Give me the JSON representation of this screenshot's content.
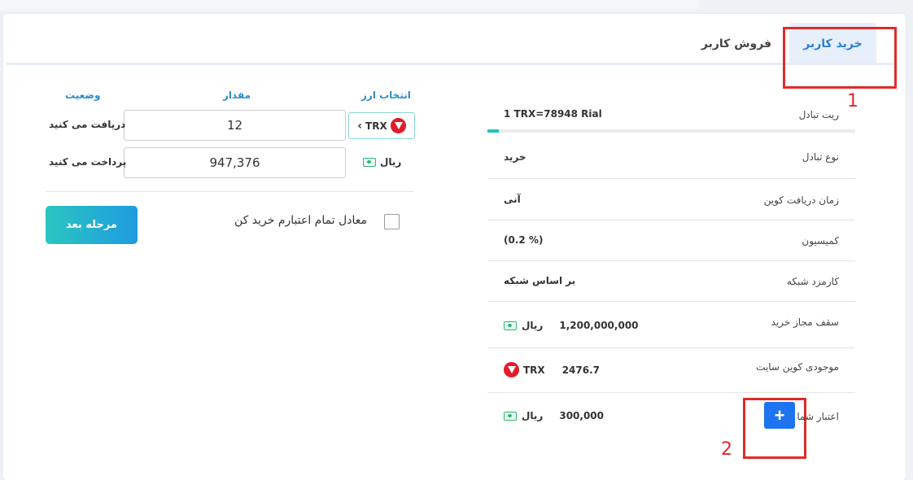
{
  "tabs": {
    "buy": "خرید کاربر",
    "sell": "فروش کاربر"
  },
  "annotations": {
    "first": "1",
    "second": "2"
  },
  "info": {
    "rate": {
      "label": "ریت تبادل",
      "value": "1 TRX=78948 Rial"
    },
    "type": {
      "label": "نوع تبادل",
      "value": "خرید"
    },
    "receive_time": {
      "label": "زمان دریافت کوین",
      "value": "آنی"
    },
    "commission": {
      "label": "کمیسیون",
      "value": "(0.2 %)"
    },
    "network_fee": {
      "label": "کارمزد شبکه",
      "value": "بر اساس شبکه"
    },
    "buy_limit": {
      "label": "سقف مجاز خرید",
      "value": "1,200,000,000",
      "unit": "ریال"
    },
    "site_balance": {
      "label": "موجودی کوین سایت",
      "value": "2476.7",
      "unit": "TRX"
    },
    "credit": {
      "label": "اعتبار شما",
      "value": "300,000",
      "unit": "ریال",
      "add_label": "+"
    }
  },
  "form": {
    "headers": {
      "currency": "انتخاب ارز",
      "amount": "مقدار",
      "status": "وضعیت"
    },
    "receive_label": "دریافت می کنید",
    "receive_value": "12",
    "pay_label": "پرداخت می کنید",
    "pay_value": "947,376",
    "coin": "TRX",
    "pay_unit": "ریال",
    "checkbox_label": "معادل تمام اعتبارم خرید کن",
    "next_button": "مرحله بعد"
  },
  "colors": {
    "accent": "#2a8ccc",
    "highlight": "#e12a2a",
    "plus_button": "#1e74f0",
    "trx_red": "#e31c2a",
    "cash_green": "#2bb673"
  },
  "icons": {
    "coin": "tron-icon",
    "cash": "cash-icon",
    "chevron": "chevron-left-icon"
  }
}
